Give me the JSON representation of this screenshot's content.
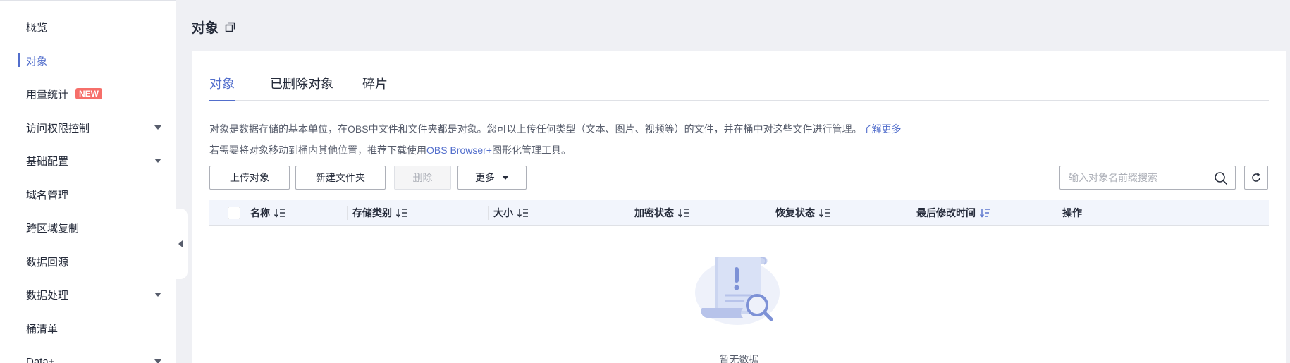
{
  "sidebar": {
    "items": [
      {
        "label": "概览"
      },
      {
        "label": "对象"
      },
      {
        "label": "用量统计",
        "badge": "NEW"
      },
      {
        "label": "访问权限控制"
      },
      {
        "label": "基础配置"
      },
      {
        "label": "域名管理"
      },
      {
        "label": "跨区域复制"
      },
      {
        "label": "数据回源"
      },
      {
        "label": "数据处理"
      },
      {
        "label": "桶清单"
      },
      {
        "label": "Data+"
      }
    ]
  },
  "page": {
    "title": "对象"
  },
  "tabs": [
    {
      "label": "对象"
    },
    {
      "label": "已删除对象"
    },
    {
      "label": "碎片"
    }
  ],
  "description": {
    "line1": "对象是数据存储的基本单位，在OBS中文件和文件夹都是对象。您可以上传任何类型（文本、图片、视频等）的文件，并在桶中对这些文件进行管理。",
    "line1_link": "了解更多",
    "line2_prefix": "若需要将对象移动到桶内其他位置，推荐下载使用",
    "line2_link": "OBS Browser+",
    "line2_suffix": "图形化管理工具。"
  },
  "toolbar": {
    "upload": "上传对象",
    "new_folder": "新建文件夹",
    "delete": "删除",
    "more": "更多"
  },
  "search": {
    "placeholder": "输入对象名前缀搜索"
  },
  "table": {
    "columns": [
      "名称",
      "存储类别",
      "大小",
      "加密状态",
      "恢复状态",
      "最后修改时间",
      "操作"
    ]
  },
  "empty": {
    "text": "暂无数据"
  },
  "colors": {
    "accent": "#526ecc",
    "badge": "#f66f6a"
  }
}
